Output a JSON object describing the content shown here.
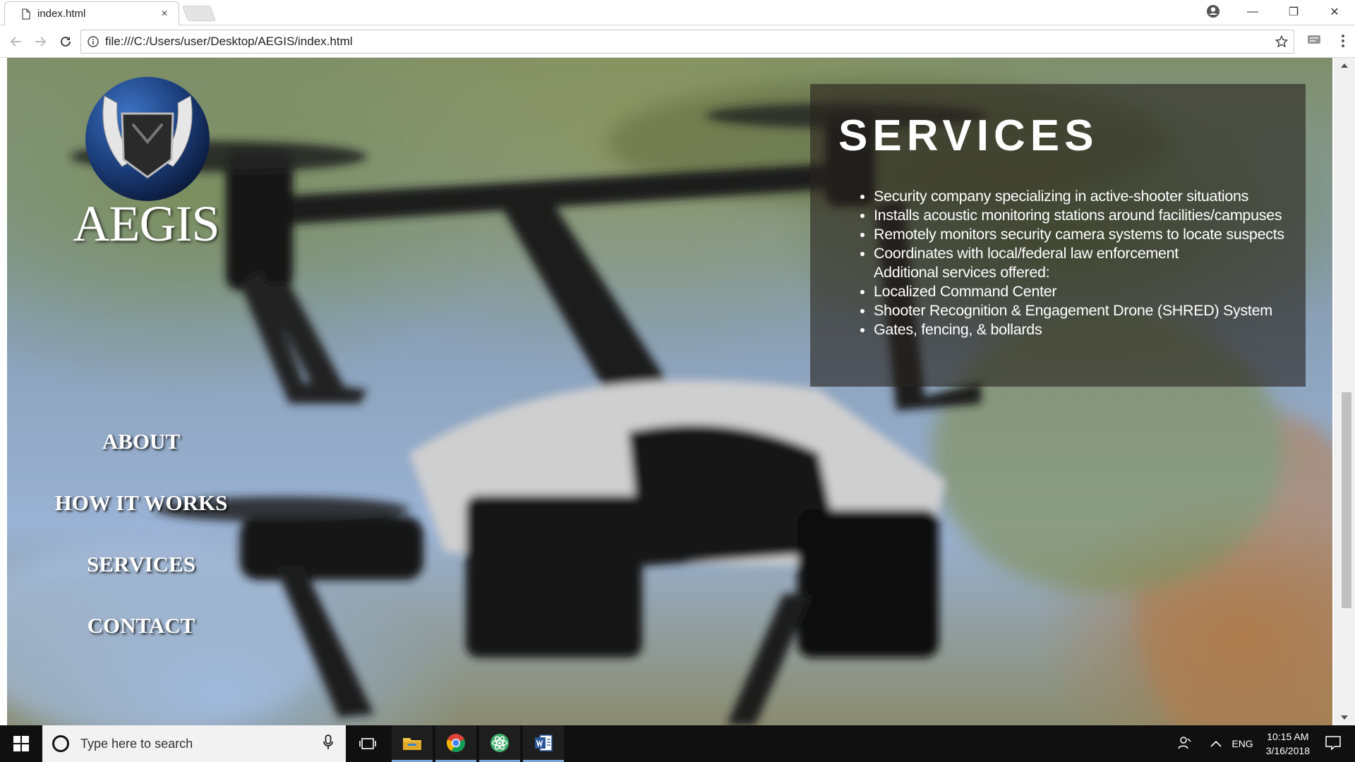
{
  "browser": {
    "tab_title": "index.html",
    "tab_close": "×",
    "url": "file:///C:/Users/user/Desktop/AEGIS/index.html",
    "window_controls": {
      "minimize": "—",
      "restore": "❐",
      "close": "✕"
    }
  },
  "page": {
    "logo_text": "AEGIS",
    "nav": [
      "ABOUT",
      "HOW IT WORKS",
      "SERVICES",
      "CONTACT"
    ],
    "services": {
      "title": "SERVICES",
      "items": [
        "Security company specializing in active-shooter situations",
        "Installs acoustic monitoring stations around facilities/campuses",
        "Remotely monitors security camera systems to locate suspects",
        "Coordinates with local/federal law enforcement",
        "Additional services offered:",
        "Localized Command Center",
        "Shooter Recognition & Engagement Drone (SHRED) System",
        "Gates, fencing, & bollards"
      ]
    }
  },
  "taskbar": {
    "search_placeholder": "Type here to search",
    "language": "ENG",
    "time": "10:15 AM",
    "date": "3/16/2018"
  },
  "icons": [
    "page-icon",
    "back-arrow-icon",
    "forward-arrow-icon",
    "reload-icon",
    "info-icon",
    "star-icon",
    "extension-icon",
    "kebab-menu-icon",
    "profile-icon",
    "windows-start-icon",
    "search-circle-icon",
    "microphone-icon",
    "task-view-icon",
    "file-explorer-icon",
    "chrome-icon",
    "atom-icon",
    "word-icon",
    "people-icon",
    "chevron-up-icon",
    "notification-icon"
  ],
  "colors": {
    "panel_bg": "#28231e",
    "text": "#ffffff",
    "taskbar": "#101010"
  }
}
